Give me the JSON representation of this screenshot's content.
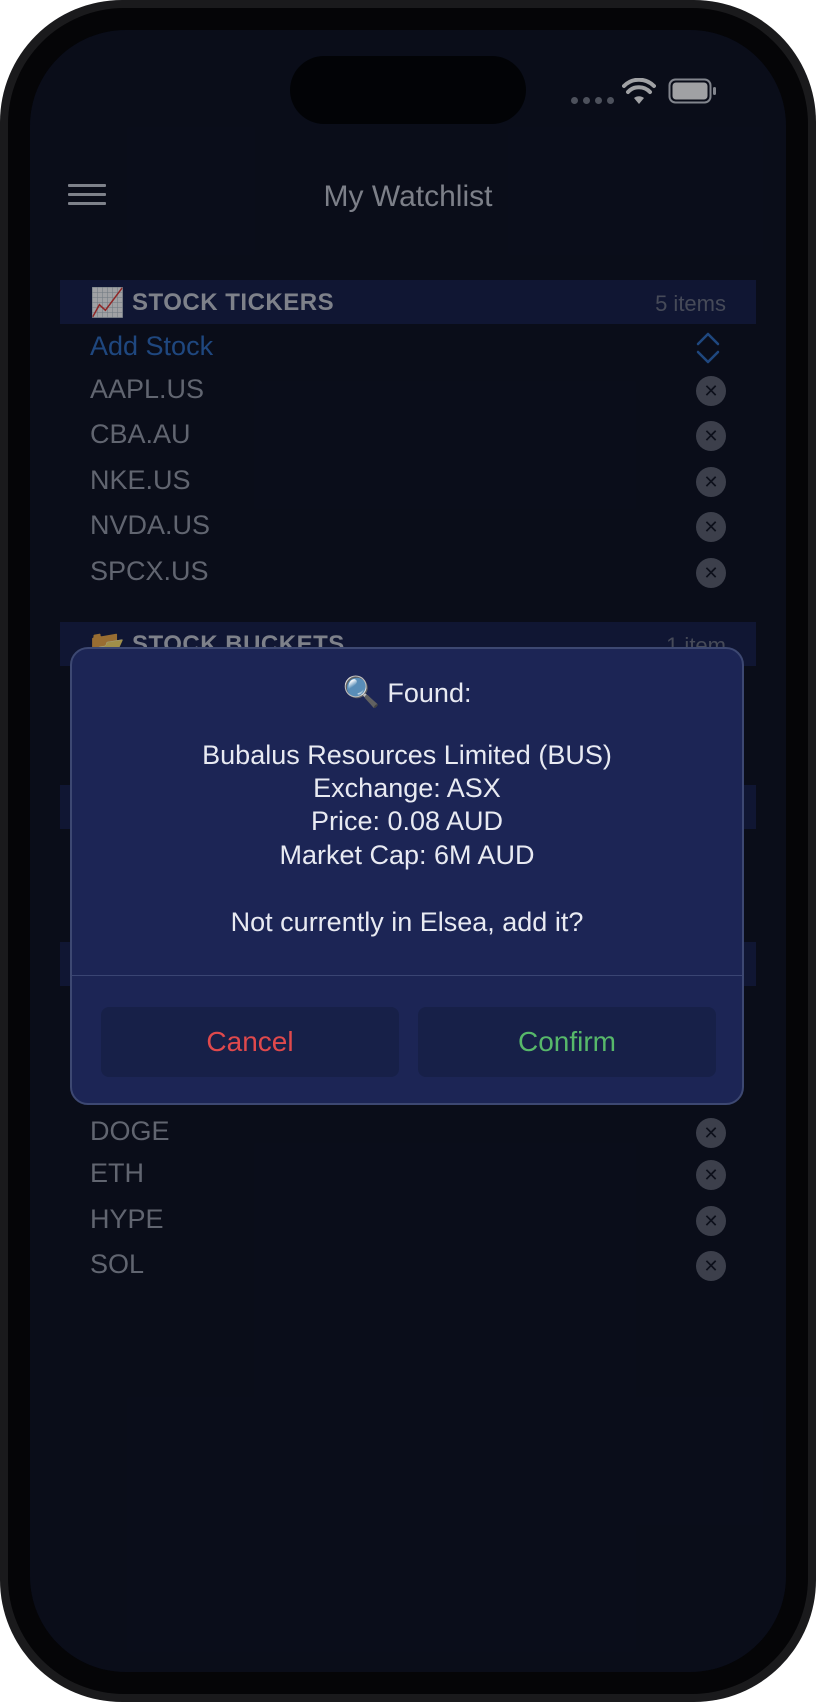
{
  "nav": {
    "title": "My Watchlist"
  },
  "sections": {
    "stock_tickers": {
      "emoji": "📈",
      "title": "STOCK TICKERS",
      "count": "5 items"
    },
    "stock_buckets": {
      "emoji": "📂",
      "title": "STOCK BUCKETS",
      "count": "1 item"
    }
  },
  "add_stock_label": "Add Stock",
  "tickers": [
    "AAPL.US",
    "CBA.AU",
    "NKE.US",
    "NVDA.US",
    "SPCX.US"
  ],
  "crypto_partial": "DOGE",
  "crypto": [
    "ETH",
    "HYPE",
    "SOL"
  ],
  "remove_glyph": "✕",
  "dialog": {
    "icon": "🔍",
    "heading": "Found:",
    "company": "Bubalus Resources Limited (BUS)",
    "exchange": "Exchange: ASX",
    "price": "Price: 0.08 AUD",
    "market_cap": "Market Cap: 6M AUD",
    "question": "Not currently in Elsea, add it?",
    "cancel_label": "Cancel",
    "confirm_label": "Confirm"
  },
  "colors": {
    "accent_blue": "#2f6fc4",
    "cancel_red": "#e0494c",
    "confirm_green": "#57b86a",
    "background": "#0d1120",
    "dialog_bg": "#1c2555"
  }
}
